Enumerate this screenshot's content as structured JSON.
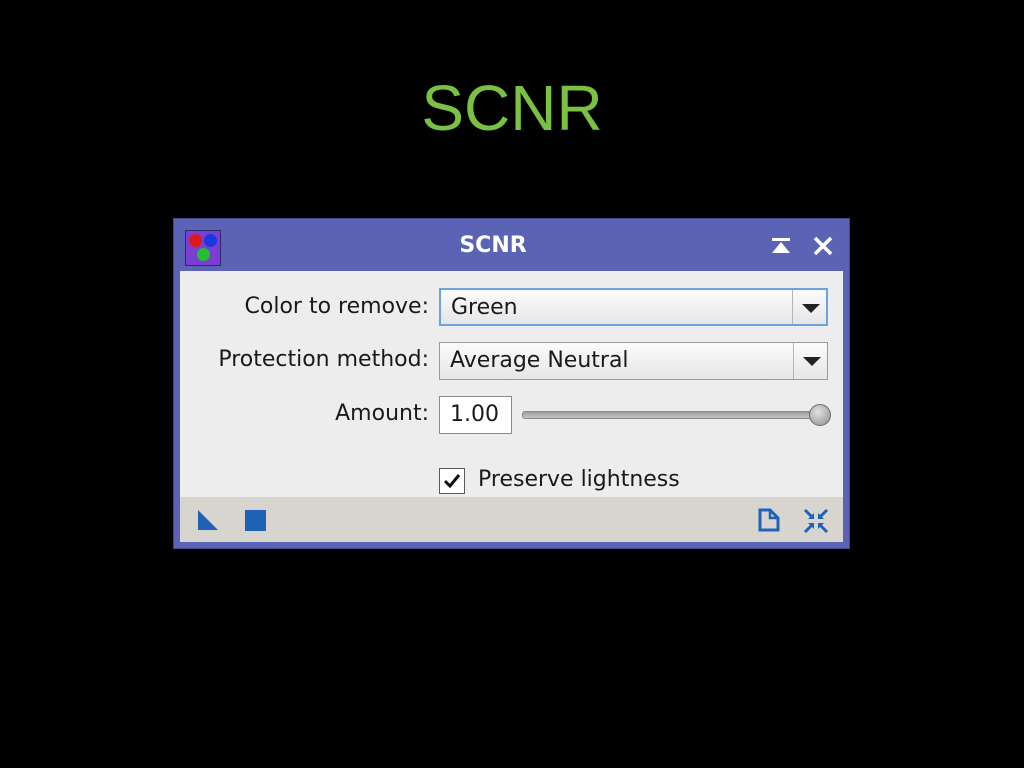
{
  "slide": {
    "title": "SCNR"
  },
  "window": {
    "title": "SCNR",
    "icon": "scnr-process-icon",
    "titlebar_buttons": [
      "shade-icon",
      "close-icon"
    ]
  },
  "form": {
    "color_to_remove": {
      "label": "Color to remove:",
      "value": "Green"
    },
    "protection_method": {
      "label": "Protection method:",
      "value": "Average Neutral"
    },
    "amount": {
      "label": "Amount:",
      "value": "1.00",
      "slider_fraction": 1.0
    },
    "preserve_lightness": {
      "label": "Preserve lightness",
      "checked": true
    }
  },
  "footer": {
    "left_icons": [
      "new-instance-icon",
      "apply-global-icon"
    ],
    "right_icons": [
      "documentation-icon",
      "reset-icon"
    ]
  },
  "colors": {
    "slide_title": "#7ac143",
    "window_frame": "#5b64b4",
    "content_bg": "#ededed",
    "footer_bg": "#d8d5cf",
    "footer_icon": "#1f63b8",
    "focus_ring": "#6aa3e0"
  }
}
